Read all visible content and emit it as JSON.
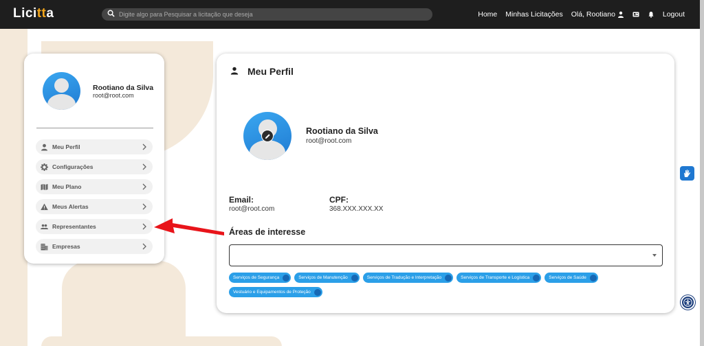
{
  "header": {
    "logo_prefix": "Lici",
    "logo_accent": "tt",
    "logo_suffix": "a",
    "search_placeholder": "Digite algo para Pesquisar a licitação que deseja",
    "nav": {
      "home": "Home",
      "minhas": "Minhas Licitações",
      "ola": "Olá, Rootiano",
      "logout": "Logout"
    }
  },
  "sidebar": {
    "name": "Rootiano da Silva",
    "email": "root@root.com",
    "items": [
      {
        "label": "Meu Perfil",
        "icon": "person-icon"
      },
      {
        "label": "Configurações",
        "icon": "gear-icon"
      },
      {
        "label": "Meu Plano",
        "icon": "map-icon"
      },
      {
        "label": "Meus Alertas",
        "icon": "warning-icon"
      },
      {
        "label": "Representantes",
        "icon": "people-icon"
      },
      {
        "label": "Empresas",
        "icon": "building-icon"
      }
    ]
  },
  "profile": {
    "title": "Meu Perfil",
    "name": "Rootiano da Silva",
    "email": "root@root.com",
    "email_label": "Email:",
    "email_value": "root@root.com",
    "cpf_label": "CPF:",
    "cpf_value": "368.XXX.XXX.XX",
    "areas_title": "Áreas de interesse",
    "chips": [
      "Serviços de Segurança",
      "Serviços de Manutenção",
      "Serviços de Tradução e Interpretação",
      "Serviços de Transporte e Logística",
      "Serviços de Saúde",
      "Vestuário e Equipamentos de Proteção"
    ]
  },
  "colors": {
    "topbar": "#1e1e1e",
    "accent": "#f2a51a",
    "chip": "#2b9fe8",
    "arrow": "#e8141a"
  }
}
